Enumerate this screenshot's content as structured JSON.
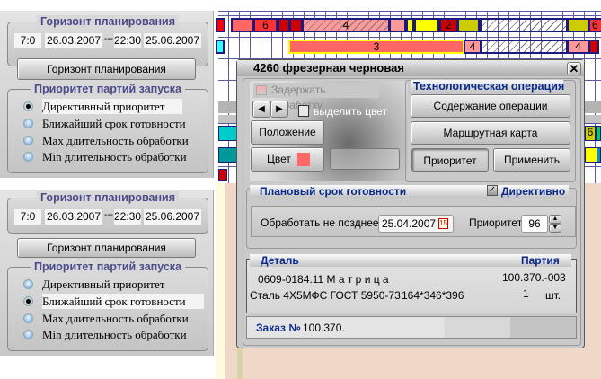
{
  "left_panels": [
    {
      "horizon_title": "Горизонт планирования",
      "start_time": "7:0",
      "start_date": "26.03.2007",
      "sep": "---",
      "end_time": "22:30",
      "end_date": "25.06.2007",
      "horizon_button": "Горизонт планирования",
      "priority_title": "Приоритет партий запуска",
      "options": [
        "Директивный приоритет",
        "Ближайший срок готовности",
        "Max длительность обработки",
        "Min  длительность обработки"
      ],
      "selected": 0
    },
    {
      "horizon_title": "Горизонт планирования",
      "start_time": "7:0",
      "start_date": "26.03.2007",
      "sep": "---",
      "end_time": "22:30",
      "end_date": "25.06.2007",
      "horizon_button": "Горизонт планирования",
      "priority_title": "Приоритет партий запуска",
      "options": [
        "Директивный приоритет",
        "Ближайший срок готовности",
        "Max длительность обработки",
        "Min  длительность обработки"
      ],
      "selected": 1
    }
  ],
  "gantt": {
    "labels": {
      "r1a": "6",
      "r1b": "4",
      "r1c": "2",
      "r1d": "6",
      "r2a": "3",
      "r2b": "4",
      "r2c": "4",
      "r3a": "6"
    }
  },
  "dialog": {
    "title": "4260 фрезерная черновая",
    "delay_label": "Задержать обработку",
    "highlight_label": "выделить цвет",
    "position_button": "Положение",
    "color_button": "Цвет",
    "color_swatch": "#ff6666",
    "tech_title": "Технологическая операция",
    "op_content_button": "Содержание операции",
    "route_button": "Маршрутная  карта",
    "priority_button": "Приоритет",
    "apply_button": "Применить",
    "plan_title": "Плановый срок готовности",
    "directive_label": "Директивно",
    "directive_checked": true,
    "deadline_label": "Обработать не позднее",
    "deadline_value": "25.04.2007",
    "calendar_icon_text": "15",
    "priority_label": "Приоритет",
    "priority_value": "96",
    "detail_header": "Деталь",
    "batch_header": "Партия",
    "detail_name": "0609-0184.11 М а т р и ц а",
    "batch_value": "100.370.-003",
    "material": "Сталь 4Х5МФС ГОСТ 5950-73",
    "dimensions": "164*346*396",
    "qty": "1",
    "unit": "шт.",
    "order_label": "Заказ №",
    "order_value": "100.370."
  }
}
